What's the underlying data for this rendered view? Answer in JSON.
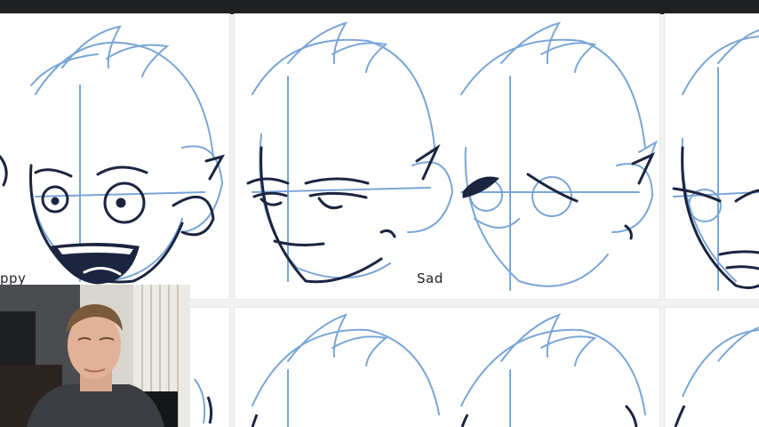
{
  "window": {
    "title": ""
  },
  "panels": [
    {
      "label": "ppy",
      "expression": "happy"
    },
    {
      "label": "Sad",
      "expression": "sad"
    },
    {
      "label": "",
      "expression": "eyes-closed"
    },
    {
      "label": "",
      "expression": "angry"
    }
  ],
  "colors": {
    "construction": "#7aa6d6",
    "ink": "#1b2540",
    "topbar": "#1f2021",
    "paper": "#ffffff"
  },
  "webcam": {
    "visible": true
  }
}
